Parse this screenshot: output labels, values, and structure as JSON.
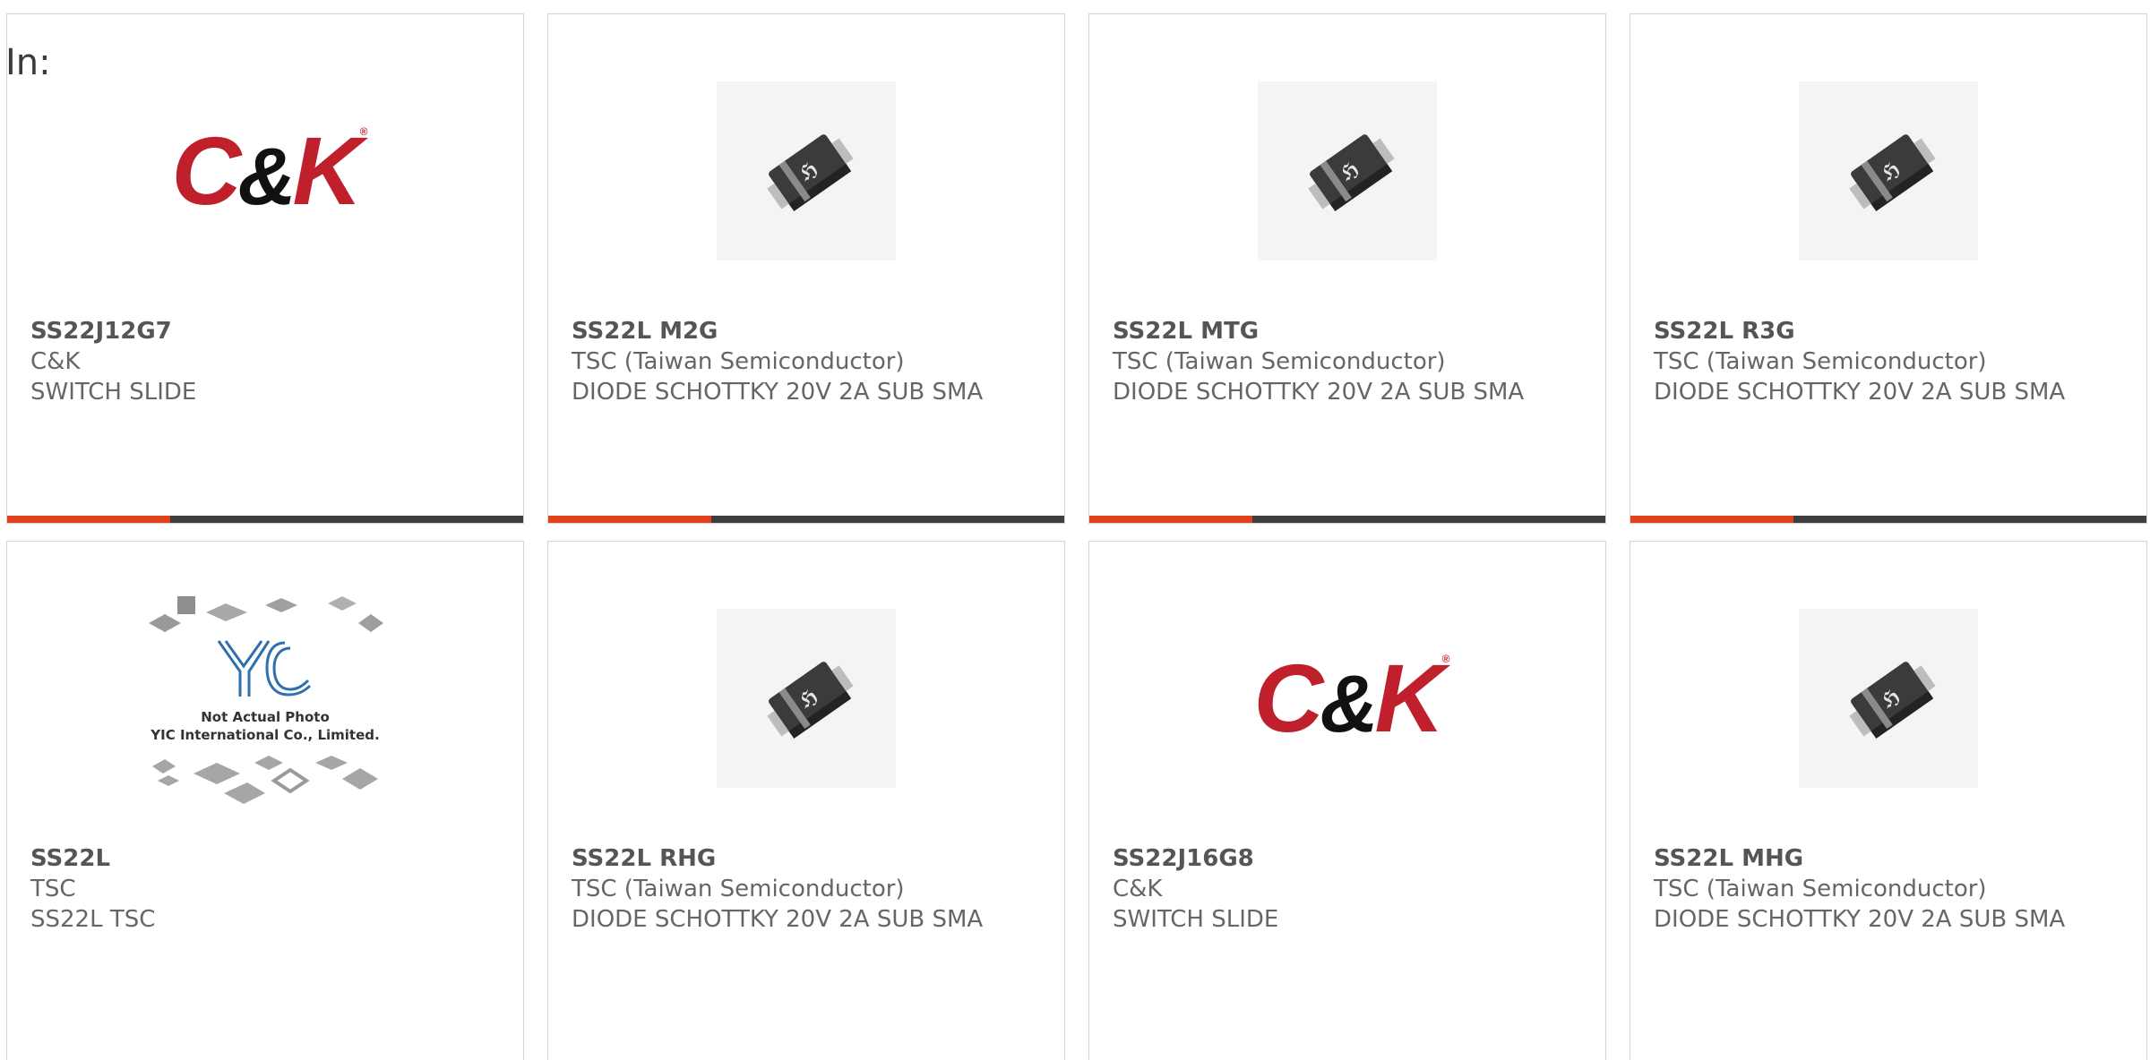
{
  "search": {
    "label": "In:"
  },
  "colors": {
    "accent": "#e0411b",
    "bar": "#3e3e3e",
    "brand_red": "#c01f2c"
  },
  "products": [
    {
      "part": "SS22J12G7",
      "manufacturer": "C&K",
      "description": "SWITCH SLIDE",
      "image": "ck-logo"
    },
    {
      "part": "SS22L M2G",
      "manufacturer": "TSC (Taiwan Semiconductor)",
      "description": "DIODE SCHOTTKY 20V 2A SUB SMA",
      "image": "diode-package"
    },
    {
      "part": "SS22L MTG",
      "manufacturer": "TSC (Taiwan Semiconductor)",
      "description": "DIODE SCHOTTKY 20V 2A SUB SMA",
      "image": "diode-package"
    },
    {
      "part": "SS22L R3G",
      "manufacturer": "TSC (Taiwan Semiconductor)",
      "description": "DIODE SCHOTTKY 20V 2A SUB SMA",
      "image": "diode-package"
    },
    {
      "part": "SS22L",
      "manufacturer": "TSC",
      "description": "SS22L TSC",
      "image": "not-actual-photo",
      "image_text": {
        "caption1": "Not Actual Photo",
        "caption2": "YIC International Co., Limited.",
        "logo": "YIC"
      }
    },
    {
      "part": "SS22L RHG",
      "manufacturer": "TSC (Taiwan Semiconductor)",
      "description": "DIODE SCHOTTKY 20V 2A SUB SMA",
      "image": "diode-package"
    },
    {
      "part": "SS22J16G8",
      "manufacturer": "C&K",
      "description": "SWITCH SLIDE",
      "image": "ck-logo"
    },
    {
      "part": "SS22L MHG",
      "manufacturer": "TSC (Taiwan Semiconductor)",
      "description": "DIODE SCHOTTKY 20V 2A SUB SMA",
      "image": "diode-package"
    }
  ]
}
